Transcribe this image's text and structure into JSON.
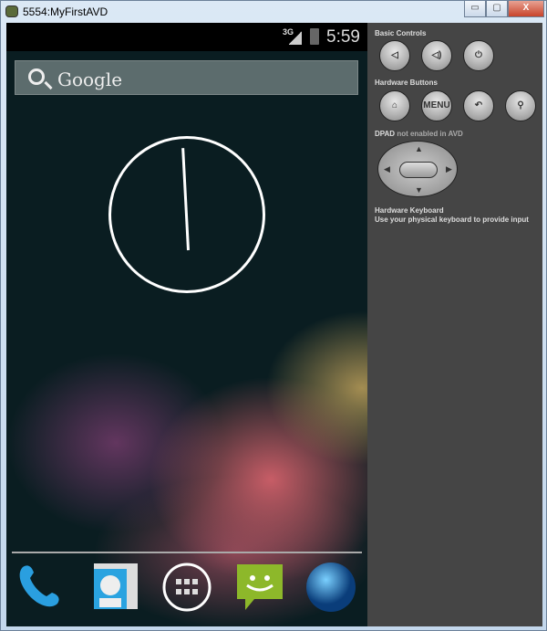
{
  "window": {
    "title": "5554:MyFirstAVD",
    "minimize": "▭",
    "maximize": "▢",
    "close": "X"
  },
  "status": {
    "network": "3G",
    "time": "5:59"
  },
  "search": {
    "label": "Google"
  },
  "dock": [
    "phone-icon",
    "contacts-icon",
    "app-drawer-icon",
    "messaging-icon",
    "browser-icon"
  ],
  "panel": {
    "basic_controls": "Basic Controls",
    "hardware_buttons": "Hardware Buttons",
    "menu_label": "MENU",
    "dpad_bold": "DPAD",
    "dpad_rest": "not enabled in AVD",
    "keyboard_title": "Hardware Keyboard",
    "keyboard_desc": "Use your physical keyboard to provide input"
  }
}
